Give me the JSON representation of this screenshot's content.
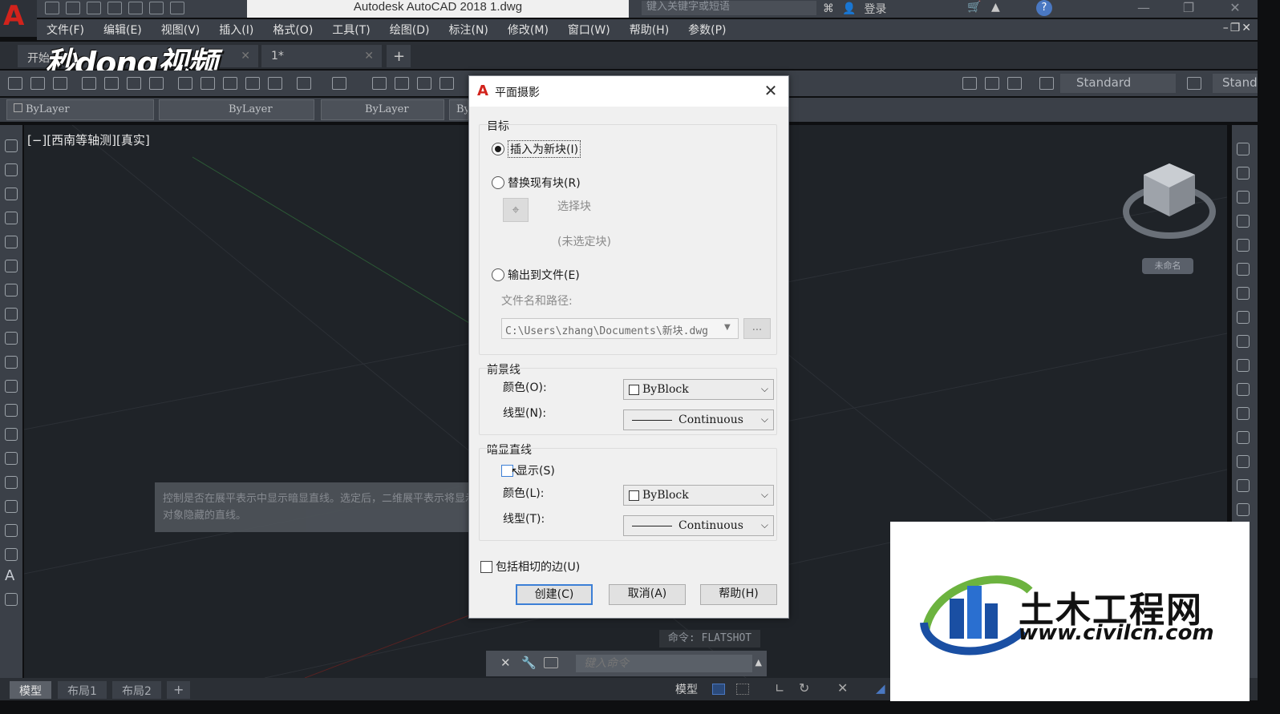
{
  "titlebar": {
    "app_title": "Autodesk AutoCAD 2018    1.dwg",
    "search_placeholder": "键入关键字或短语",
    "login_label": "登录"
  },
  "menubar": {
    "items": [
      "文件(F)",
      "编辑(E)",
      "视图(V)",
      "插入(I)",
      "格式(O)",
      "工具(T)",
      "绘图(D)",
      "标注(N)",
      "修改(M)",
      "窗口(W)",
      "帮助(H)",
      "参数(P)"
    ]
  },
  "tabs": {
    "start_tab": "开始",
    "doc_tab": "1*",
    "new_tab": "+"
  },
  "watermark_top": "秒dong视频",
  "toolbar2": {
    "layer": "ByLayer",
    "linetype": "ByLayer",
    "lineweight": "ByLayer",
    "partial": "By"
  },
  "styles": {
    "text_style": "Standard",
    "dim_style": "Stand"
  },
  "viewport": {
    "label": "[−][西南等轴测][真实]",
    "unnamed_badge": "未命名"
  },
  "tooltip": {
    "text": "控制是否在展平表示中显示暗显直线。选定后，二维展平表示将显示其他对象隐藏的直线。"
  },
  "command": {
    "history": "命令: FLATSHOT",
    "placeholder": "键入命令"
  },
  "statusbar": {
    "layouts": [
      "模型",
      "布局1",
      "布局2"
    ],
    "add_layout": "+",
    "model_label": "模型"
  },
  "dialog": {
    "title": "平面摄影",
    "target_section": "目标",
    "opt_insert": "插入为新块(I)",
    "opt_replace": "替换现有块(R)",
    "select_block": "选择块",
    "no_block": "(未选定块)",
    "opt_export": "输出到文件(E)",
    "filename_label": "文件名和路径:",
    "filename_value": "C:\\Users\\zhang\\Documents\\新块.dwg",
    "browse_label": "...",
    "fg_section": "前景线",
    "fg_color_label": "颜色(O):",
    "fg_color_value": "ByBlock",
    "fg_linetype_label": "线型(N):",
    "fg_linetype_value": "Continuous",
    "obscured_section": "暗显直线",
    "show_label": "显示(S)",
    "obs_color_label": "颜色(L):",
    "obs_color_value": "ByBlock",
    "obs_linetype_label": "线型(T):",
    "obs_linetype_value": "Continuous",
    "tangent_label": "包括相切的边(U)",
    "btn_create": "创建(C)",
    "btn_cancel": "取消(A)",
    "btn_help": "帮助(H)"
  },
  "corner_watermark": {
    "name": "土木工程网",
    "url": "www.civilcn.com"
  },
  "colors": {
    "accent_red": "#d2231c",
    "viewport_bg": "#1f2328",
    "chrome_bg": "#3b4048",
    "focus_blue": "#3c7fd6"
  }
}
